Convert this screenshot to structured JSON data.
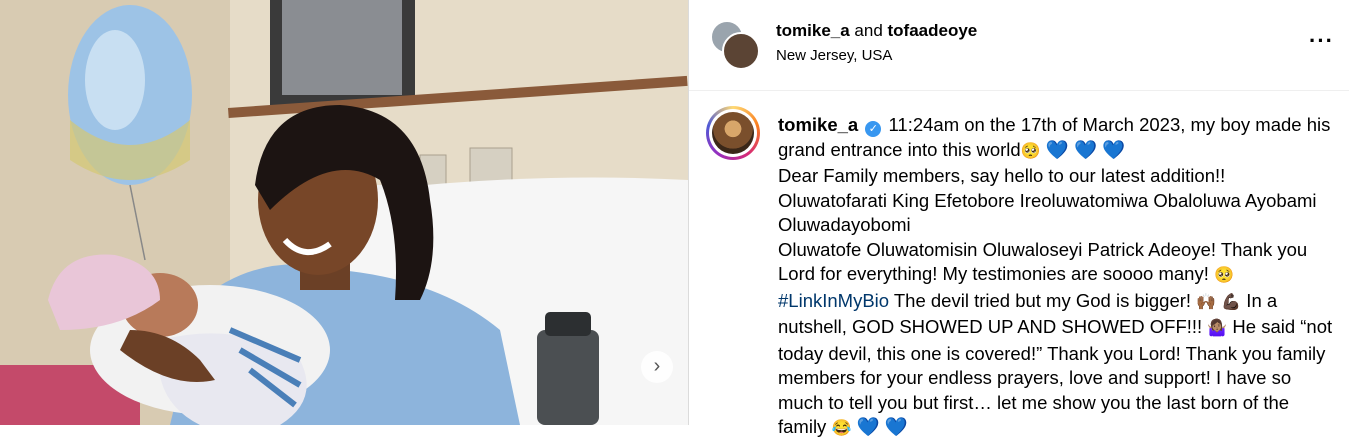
{
  "header": {
    "username": "tomike_a",
    "connector": " and ",
    "coauthor": "tofaadeoye",
    "location": "New Jersey, USA",
    "more_icon": "more-options-icon"
  },
  "caption": {
    "username": "tomike_a",
    "line1": "11:24am on the 17th of March 2023, my boy made his grand entrance into this world",
    "line2": "Dear Family members, say hello to our latest addition!!",
    "line3": "Oluwatofarati King Efetobore Ireoluwatomiwa Obaloluwa Ayobami Oluwadayobomi",
    "line4": "Oluwatofe Oluwatomisin Oluwaloseyi Patrick Adeoye! Thank you Lord for everything! My testimonies are soooo many!",
    "hashtag": "#LinkInMyBio",
    "line5a": " The devil tried but my God is bigger! ",
    "line5b": " In a nutshell, GOD SHOWED UP AND SHOWED OFF!!! ",
    "line5c": " He said “not today devil, this one is covered!” Thank you Lord! Thank you family members for your endless prayers, love and support! I have so much to tell you but first… let me show you the last born of the family "
  },
  "emoji": {
    "pleading": "🥺",
    "blue_heart": "💙",
    "raised_hands": "🙌🏾",
    "flexed_biceps": "💪🏿",
    "shrug": "🤷🏽‍♀️",
    "joy": "😂"
  },
  "media": {
    "next_icon": "chevron-right-icon"
  }
}
